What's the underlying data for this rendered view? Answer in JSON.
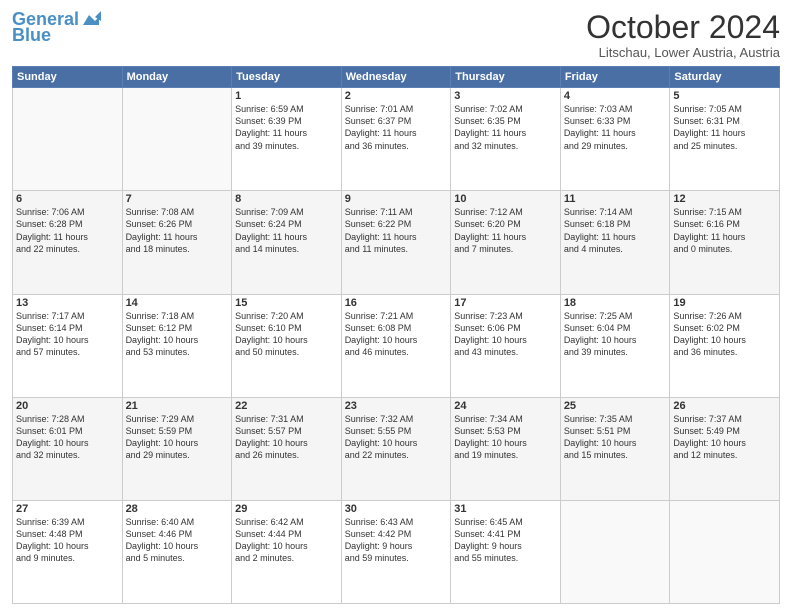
{
  "header": {
    "logo_line1": "General",
    "logo_line2": "Blue",
    "month": "October 2024",
    "location": "Litschau, Lower Austria, Austria"
  },
  "weekdays": [
    "Sunday",
    "Monday",
    "Tuesday",
    "Wednesday",
    "Thursday",
    "Friday",
    "Saturday"
  ],
  "weeks": [
    [
      {
        "day": "",
        "info": ""
      },
      {
        "day": "",
        "info": ""
      },
      {
        "day": "1",
        "info": "Sunrise: 6:59 AM\nSunset: 6:39 PM\nDaylight: 11 hours\nand 39 minutes."
      },
      {
        "day": "2",
        "info": "Sunrise: 7:01 AM\nSunset: 6:37 PM\nDaylight: 11 hours\nand 36 minutes."
      },
      {
        "day": "3",
        "info": "Sunrise: 7:02 AM\nSunset: 6:35 PM\nDaylight: 11 hours\nand 32 minutes."
      },
      {
        "day": "4",
        "info": "Sunrise: 7:03 AM\nSunset: 6:33 PM\nDaylight: 11 hours\nand 29 minutes."
      },
      {
        "day": "5",
        "info": "Sunrise: 7:05 AM\nSunset: 6:31 PM\nDaylight: 11 hours\nand 25 minutes."
      }
    ],
    [
      {
        "day": "6",
        "info": "Sunrise: 7:06 AM\nSunset: 6:28 PM\nDaylight: 11 hours\nand 22 minutes."
      },
      {
        "day": "7",
        "info": "Sunrise: 7:08 AM\nSunset: 6:26 PM\nDaylight: 11 hours\nand 18 minutes."
      },
      {
        "day": "8",
        "info": "Sunrise: 7:09 AM\nSunset: 6:24 PM\nDaylight: 11 hours\nand 14 minutes."
      },
      {
        "day": "9",
        "info": "Sunrise: 7:11 AM\nSunset: 6:22 PM\nDaylight: 11 hours\nand 11 minutes."
      },
      {
        "day": "10",
        "info": "Sunrise: 7:12 AM\nSunset: 6:20 PM\nDaylight: 11 hours\nand 7 minutes."
      },
      {
        "day": "11",
        "info": "Sunrise: 7:14 AM\nSunset: 6:18 PM\nDaylight: 11 hours\nand 4 minutes."
      },
      {
        "day": "12",
        "info": "Sunrise: 7:15 AM\nSunset: 6:16 PM\nDaylight: 11 hours\nand 0 minutes."
      }
    ],
    [
      {
        "day": "13",
        "info": "Sunrise: 7:17 AM\nSunset: 6:14 PM\nDaylight: 10 hours\nand 57 minutes."
      },
      {
        "day": "14",
        "info": "Sunrise: 7:18 AM\nSunset: 6:12 PM\nDaylight: 10 hours\nand 53 minutes."
      },
      {
        "day": "15",
        "info": "Sunrise: 7:20 AM\nSunset: 6:10 PM\nDaylight: 10 hours\nand 50 minutes."
      },
      {
        "day": "16",
        "info": "Sunrise: 7:21 AM\nSunset: 6:08 PM\nDaylight: 10 hours\nand 46 minutes."
      },
      {
        "day": "17",
        "info": "Sunrise: 7:23 AM\nSunset: 6:06 PM\nDaylight: 10 hours\nand 43 minutes."
      },
      {
        "day": "18",
        "info": "Sunrise: 7:25 AM\nSunset: 6:04 PM\nDaylight: 10 hours\nand 39 minutes."
      },
      {
        "day": "19",
        "info": "Sunrise: 7:26 AM\nSunset: 6:02 PM\nDaylight: 10 hours\nand 36 minutes."
      }
    ],
    [
      {
        "day": "20",
        "info": "Sunrise: 7:28 AM\nSunset: 6:01 PM\nDaylight: 10 hours\nand 32 minutes."
      },
      {
        "day": "21",
        "info": "Sunrise: 7:29 AM\nSunset: 5:59 PM\nDaylight: 10 hours\nand 29 minutes."
      },
      {
        "day": "22",
        "info": "Sunrise: 7:31 AM\nSunset: 5:57 PM\nDaylight: 10 hours\nand 26 minutes."
      },
      {
        "day": "23",
        "info": "Sunrise: 7:32 AM\nSunset: 5:55 PM\nDaylight: 10 hours\nand 22 minutes."
      },
      {
        "day": "24",
        "info": "Sunrise: 7:34 AM\nSunset: 5:53 PM\nDaylight: 10 hours\nand 19 minutes."
      },
      {
        "day": "25",
        "info": "Sunrise: 7:35 AM\nSunset: 5:51 PM\nDaylight: 10 hours\nand 15 minutes."
      },
      {
        "day": "26",
        "info": "Sunrise: 7:37 AM\nSunset: 5:49 PM\nDaylight: 10 hours\nand 12 minutes."
      }
    ],
    [
      {
        "day": "27",
        "info": "Sunrise: 6:39 AM\nSunset: 4:48 PM\nDaylight: 10 hours\nand 9 minutes."
      },
      {
        "day": "28",
        "info": "Sunrise: 6:40 AM\nSunset: 4:46 PM\nDaylight: 10 hours\nand 5 minutes."
      },
      {
        "day": "29",
        "info": "Sunrise: 6:42 AM\nSunset: 4:44 PM\nDaylight: 10 hours\nand 2 minutes."
      },
      {
        "day": "30",
        "info": "Sunrise: 6:43 AM\nSunset: 4:42 PM\nDaylight: 9 hours\nand 59 minutes."
      },
      {
        "day": "31",
        "info": "Sunrise: 6:45 AM\nSunset: 4:41 PM\nDaylight: 9 hours\nand 55 minutes."
      },
      {
        "day": "",
        "info": ""
      },
      {
        "day": "",
        "info": ""
      }
    ]
  ]
}
